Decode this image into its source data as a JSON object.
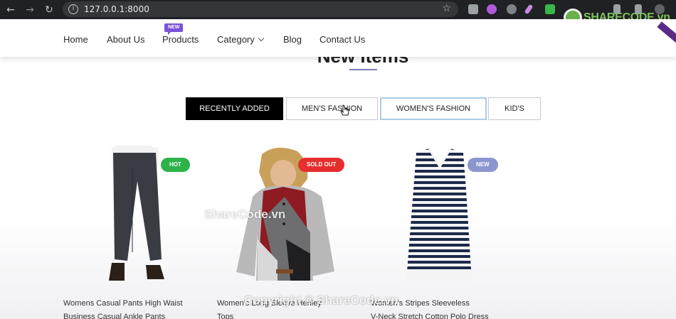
{
  "browser": {
    "url": "127.0.0.1:8000",
    "back_glyph": "←",
    "forward_glyph": "→",
    "reload_glyph": "↻",
    "info_glyph": "i",
    "star_glyph": "☆"
  },
  "watermark": {
    "logo_text": "SHARECODE.vn",
    "center_text": "ShareCode.vn",
    "copyright_text": "Copyright © ShareCode.vn"
  },
  "nav": {
    "items": [
      {
        "label": "Home"
      },
      {
        "label": "About Us"
      },
      {
        "label": "Products",
        "badge": "NEW"
      },
      {
        "label": "Category"
      },
      {
        "label": "Blog"
      },
      {
        "label": "Contact Us"
      }
    ]
  },
  "section": {
    "title": "New Items"
  },
  "tabs": [
    {
      "label": "RECENTLY ADDED",
      "active": true
    },
    {
      "label": "MEN'S FASHION",
      "active": false
    },
    {
      "label": "WOMEN'S FASHION",
      "active": false
    },
    {
      "label": "KID'S",
      "active": false
    }
  ],
  "products": [
    {
      "badge": "HOT",
      "title_line1": "Womens Casual Pants High Waist",
      "title_line2": "Business Casual Ankle Pants"
    },
    {
      "badge": "SOLD OUT",
      "title_line1": "Women's Long Sleeve Henley",
      "title_line2": "Tops"
    },
    {
      "badge": "NEW",
      "title_line1": "Women's Stripes Sleeveless",
      "title_line2": "V-Neck Stretch Cotton Polo Dress"
    }
  ],
  "colors": {
    "accent_purple": "#7b52d8",
    "hot_green": "#2db34a",
    "soldout_red": "#e62e2e",
    "new_blue": "#8b96cf",
    "tab_active_bg": "#000000"
  },
  "icons": [
    "back-arrow-icon",
    "forward-arrow-icon",
    "reload-icon",
    "info-icon",
    "bookmark-star-icon",
    "chevron-down-icon",
    "mouse-cursor-icon"
  ]
}
